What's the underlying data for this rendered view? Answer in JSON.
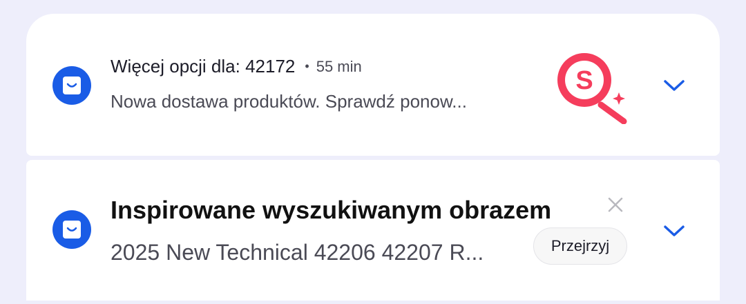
{
  "notifications": [
    {
      "title": "Więcej opcji dla: 42172",
      "separator": "•",
      "time": "55 min",
      "body": "Nowa dostawa produktów. Sprawdź ponow...",
      "thumbnail_letter": "S",
      "thumbnail_icon": "magnifier-sparkle-icon",
      "app_icon": "shopping-bag-icon",
      "expand_icon": "chevron-down-icon",
      "accent_color": "#f53d5c"
    },
    {
      "title": "Inspirowane wyszukiwanym obrazem",
      "body": "2025 New Technical 42206 42207 R...",
      "action_label": "Przejrzyj",
      "close_icon": "close-icon",
      "app_icon": "shopping-bag-icon",
      "expand_icon": "chevron-down-icon"
    }
  ],
  "colors": {
    "background": "#eeeefb",
    "card": "#ffffff",
    "brand_blue": "#1a5ce6"
  }
}
